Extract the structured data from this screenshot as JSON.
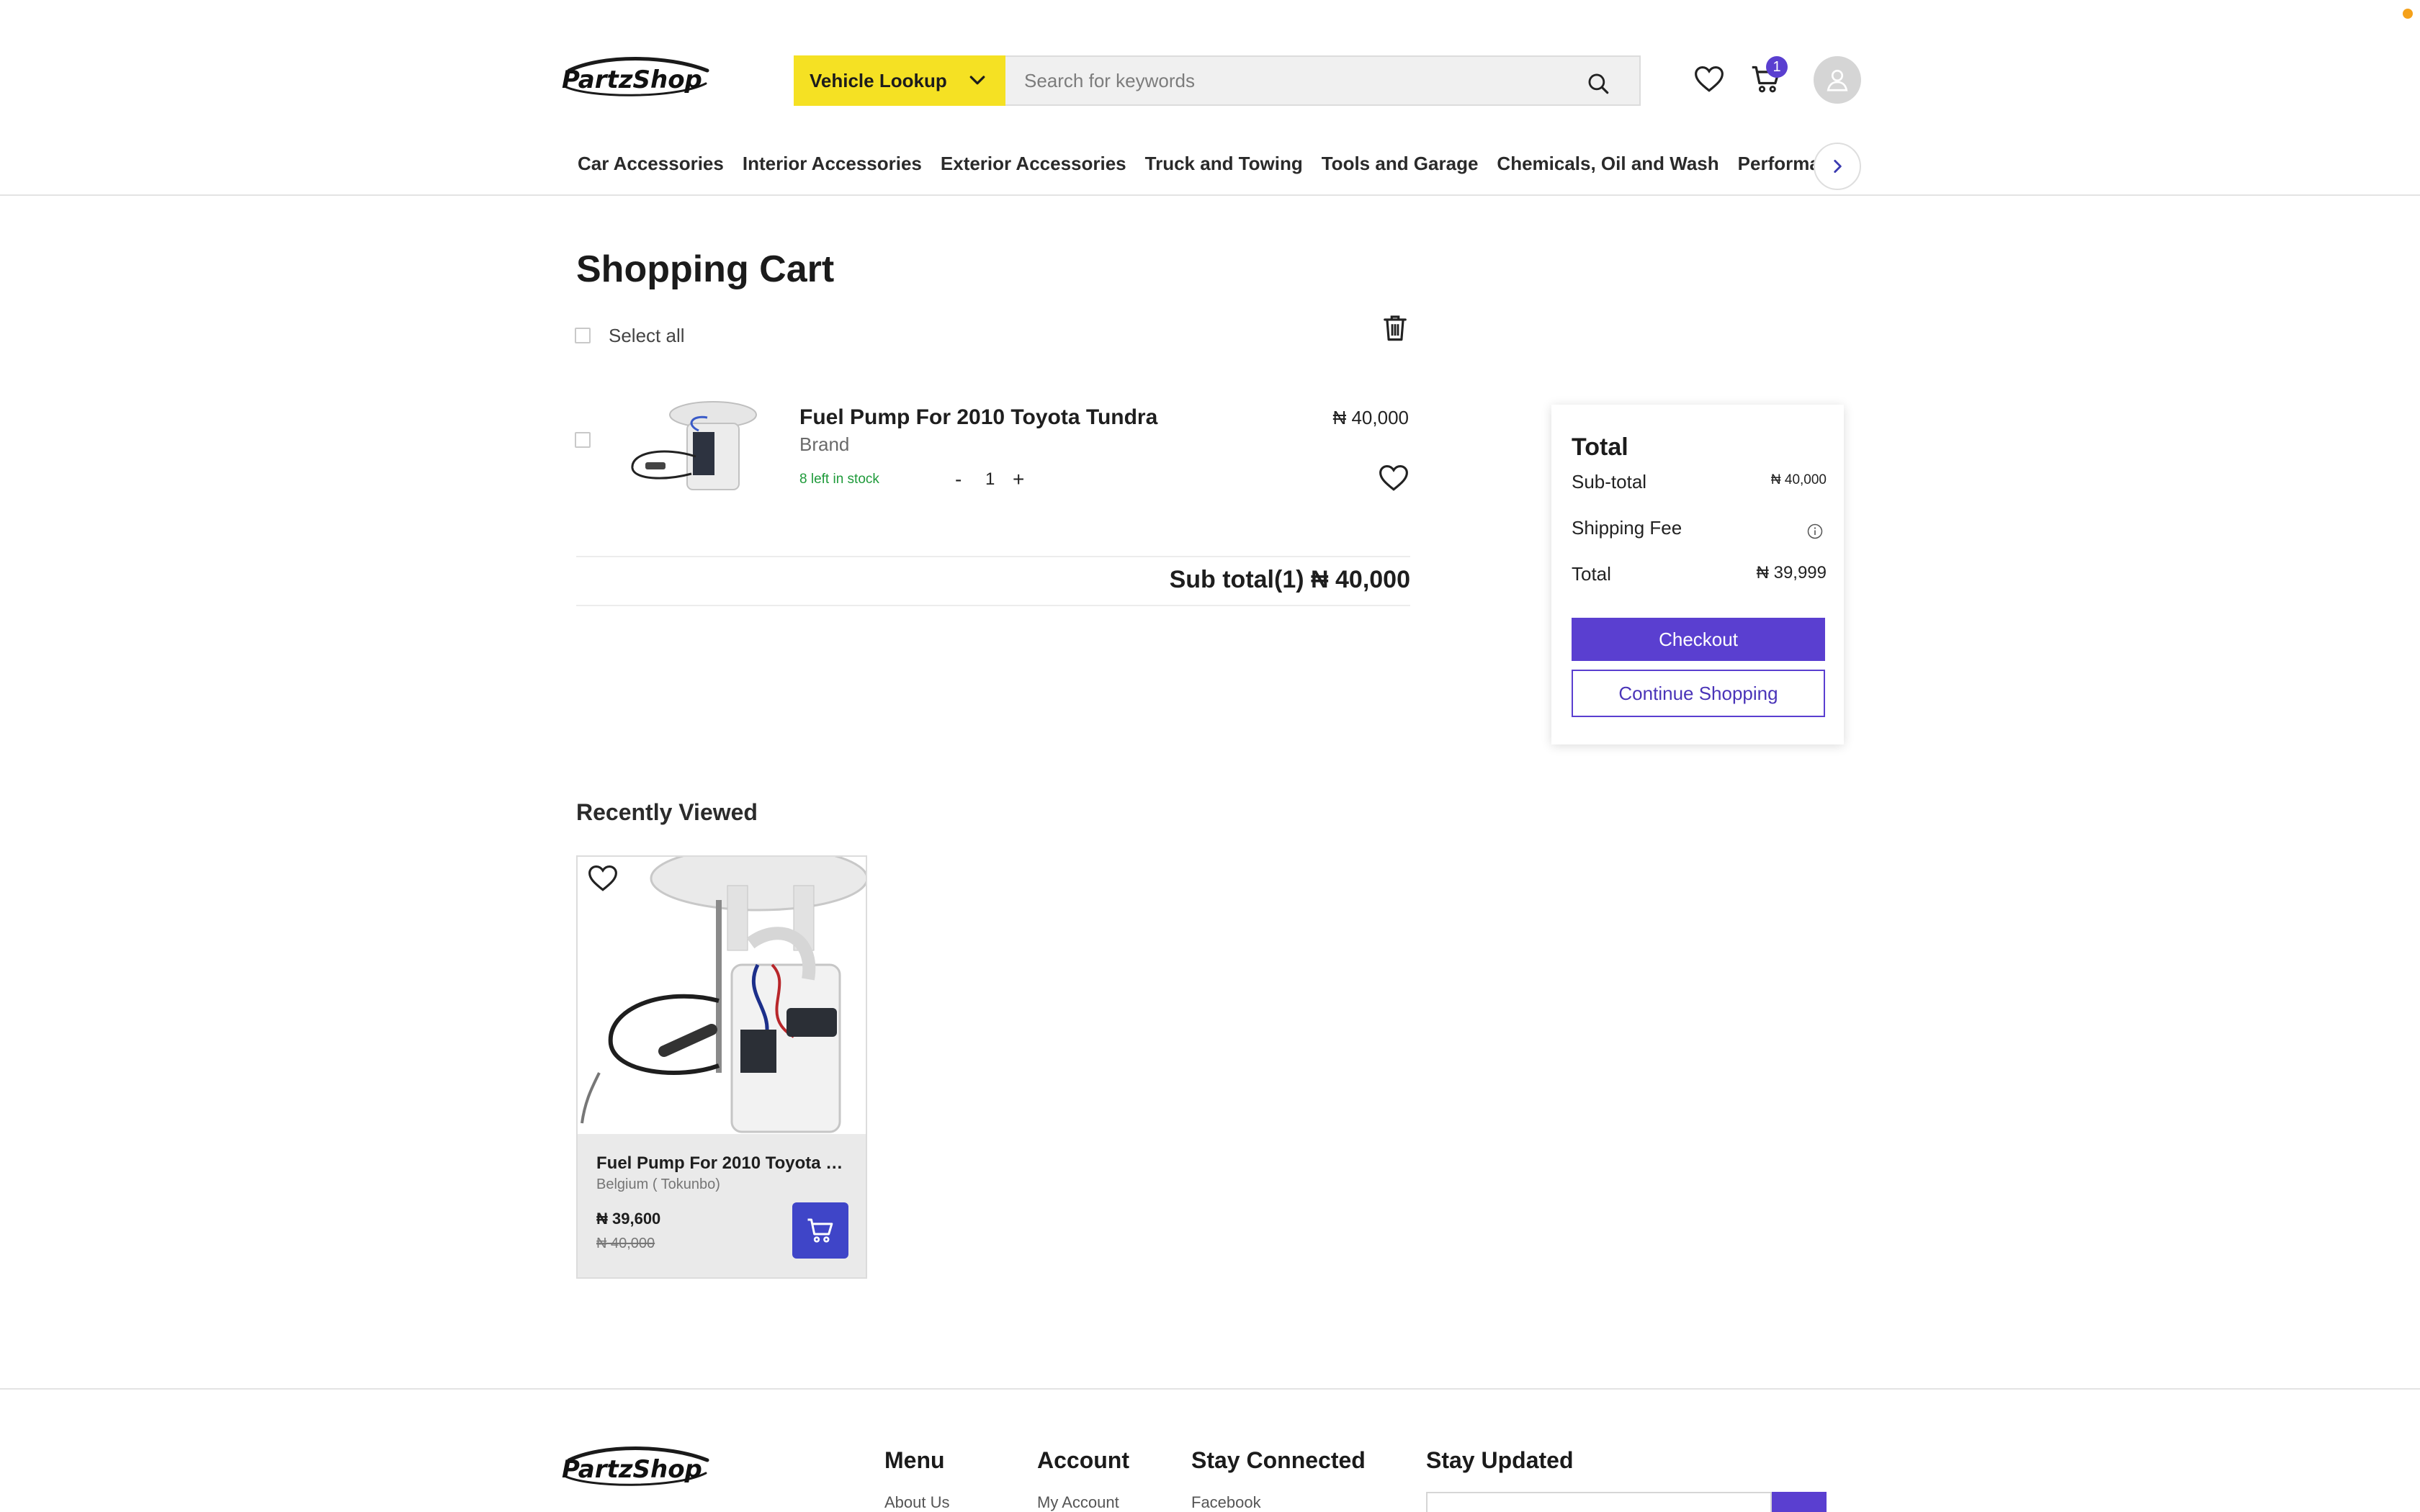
{
  "header": {
    "brand": "PartzShop",
    "vehicle_lookup_label": "Vehicle Lookup",
    "search_placeholder": "Search for keywords",
    "cart_count": "1",
    "nav_items": [
      "Car Accessories",
      "Interior Accessories",
      "Exterior Accessories",
      "Truck and Towing",
      "Tools and Garage",
      "Chemicals, Oil and Wash",
      "Performance"
    ]
  },
  "cart": {
    "title": "Shopping Cart",
    "select_all_label": "Select all",
    "items": [
      {
        "name": "Fuel Pump For 2010 Toyota Tundra",
        "brand": "Brand",
        "stock": "8 left in stock",
        "quantity": "1",
        "price": "₦ 40,000"
      }
    ],
    "subtotal_text": "Sub total(1) ₦ 40,000"
  },
  "summary": {
    "title": "Total",
    "subtotal_label": "Sub-total",
    "subtotal_value": "₦ 40,000",
    "shipping_label": "Shipping Fee",
    "total_label": "Total",
    "total_value": "₦ 39,999",
    "checkout_label": "Checkout",
    "continue_label": "Continue Shopping"
  },
  "recently_viewed": {
    "title": "Recently Viewed",
    "items": [
      {
        "name": "Fuel Pump For 2010 Toyota Tu...",
        "origin": "Belgium ( Tokunbo)",
        "price": "₦ 39,600",
        "old_price": "₦ 40,000"
      }
    ]
  },
  "footer": {
    "brand": "PartzShop",
    "menu_title": "Menu",
    "menu_link": "About Us",
    "account_title": "Account",
    "account_link": "My Account",
    "connected_title": "Stay Connected",
    "connected_link": "Facebook",
    "updated_title": "Stay Updated"
  },
  "colors": {
    "accent": "#5a3fd0",
    "vehicle_lookup_bg": "#f5e123",
    "stock_green": "#1e9a3a",
    "cart_button": "#3f45c8"
  },
  "icons": [
    "partzshop-logo",
    "chevron-down-icon",
    "search-icon",
    "heart-icon",
    "cart-icon",
    "user-icon",
    "chevron-right-icon",
    "trash-icon",
    "info-icon",
    "add-to-cart-icon"
  ]
}
